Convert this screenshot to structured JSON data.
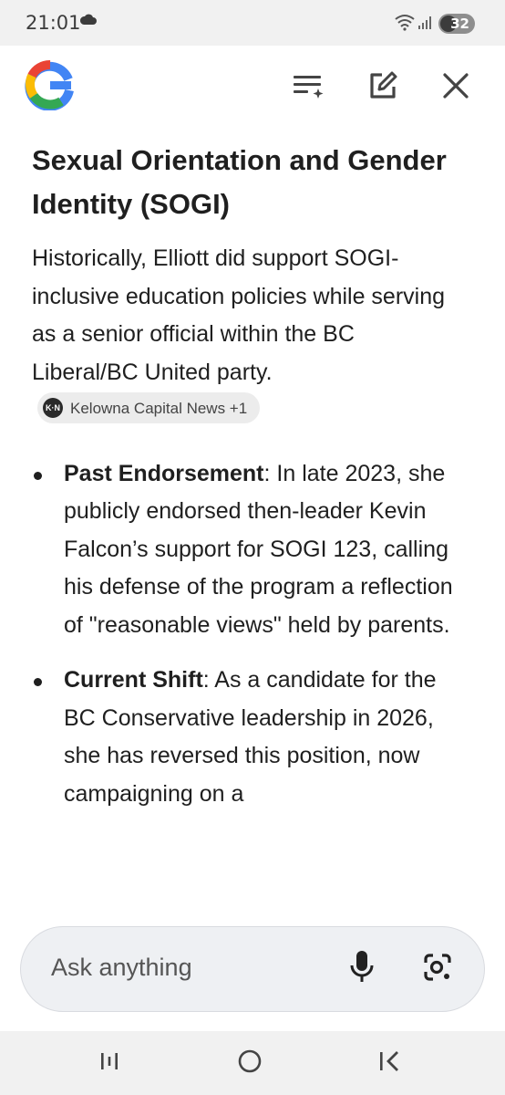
{
  "status_bar": {
    "time": "21:01",
    "battery": "32"
  },
  "header": {
    "logo": "G"
  },
  "article": {
    "heading": "Sexual Orientation and Gender Identity (SOGI)",
    "intro": "Historically, Elliott did support SOGI-inclusive education policies while serving as a senior official within the BC Liberal/BC United party.",
    "source_chip": {
      "label": "Kelowna Capital News +1",
      "logo_text": "K·N"
    },
    "bullets": [
      {
        "title": "Past Endorsement",
        "text": ": In late 2023, she publicly endorsed then-leader Kevin Falcon’s support for SOGI 123, calling his defense of the program a reflection of \"reasonable views\" held by parents."
      },
      {
        "title": "Current Shift",
        "text": ": As a candidate for the BC Conservative leadership in 2026, she has reversed this position, now campaigning on a"
      }
    ]
  },
  "ask_bar": {
    "placeholder": "Ask anything"
  },
  "icons": {
    "cloud": "cloud-icon",
    "wifi": "wifi-icon",
    "signal": "signal-icon",
    "history": "history-sparkle-icon",
    "edit": "edit-icon",
    "close": "close-icon",
    "mic": "mic-icon",
    "lens": "lens-icon",
    "recent": "recent-apps-icon",
    "home": "home-icon",
    "back": "back-icon"
  }
}
